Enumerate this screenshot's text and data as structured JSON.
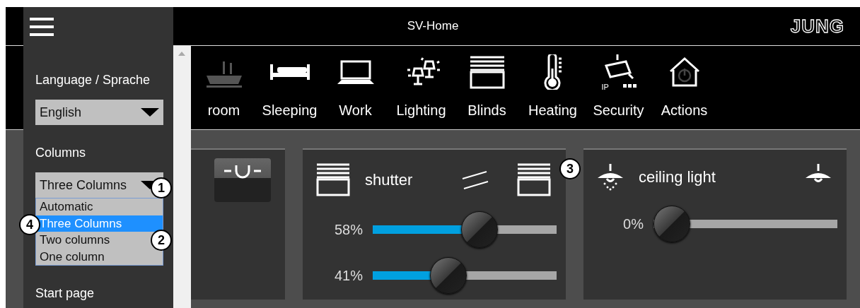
{
  "header": {
    "title": "SV-Home",
    "logo": "JUNG"
  },
  "nav": [
    {
      "label": "room"
    },
    {
      "label": "Sleeping"
    },
    {
      "label": "Work"
    },
    {
      "label": "Lighting"
    },
    {
      "label": "Blinds"
    },
    {
      "label": "Heating"
    },
    {
      "label": "Security",
      "icon_label": "IP"
    },
    {
      "label": "Actions"
    }
  ],
  "cards": [
    {
      "kind": "switch"
    },
    {
      "kind": "shutter",
      "title": "shutter",
      "sliders": [
        {
          "reading": "58%",
          "level": 0.58
        },
        {
          "reading": "41%",
          "level": 0.41
        }
      ]
    },
    {
      "kind": "light",
      "title": "ceiling light",
      "sliders": [
        {
          "reading": "0%",
          "level": 0
        }
      ]
    }
  ],
  "settings": [
    {
      "label": "Language / Sprache",
      "value": "English"
    },
    {
      "label": "Columns",
      "value": "Three Columns",
      "expanded": true,
      "options": [
        {
          "label": "Automatic",
          "selected": false
        },
        {
          "label": "Three Columns",
          "selected": true
        },
        {
          "label": "Two columns",
          "selected": false
        },
        {
          "label": "One column",
          "selected": false
        }
      ]
    },
    {
      "label": "Start page"
    }
  ],
  "callouts": [
    {
      "label": "1"
    },
    {
      "label": "2"
    },
    {
      "label": "3"
    },
    {
      "label": "4"
    }
  ]
}
